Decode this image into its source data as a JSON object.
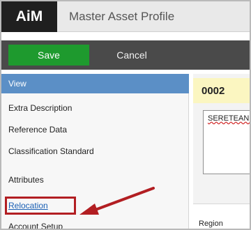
{
  "app": {
    "logo": "AiM",
    "title": "Master Asset Profile"
  },
  "toolbar": {
    "save_label": "Save",
    "cancel_label": "Cancel"
  },
  "sidebar": {
    "header": "View",
    "items": [
      {
        "label": "Extra Description"
      },
      {
        "label": "Reference Data"
      },
      {
        "label": "Classification Standard"
      },
      {
        "label": "Attributes"
      },
      {
        "label": "Relocation"
      },
      {
        "label": "Account Setup"
      }
    ]
  },
  "main": {
    "record_id": "0002",
    "description_value": "SERETEANU",
    "region_label": "Region"
  },
  "colors": {
    "save_button": "#1e9a2e",
    "sidebar_header": "#5b8fc6",
    "annotation": "#b21e22",
    "id_band": "#fbf6c1"
  },
  "annotations": {
    "highlighted_item": "Relocation"
  }
}
